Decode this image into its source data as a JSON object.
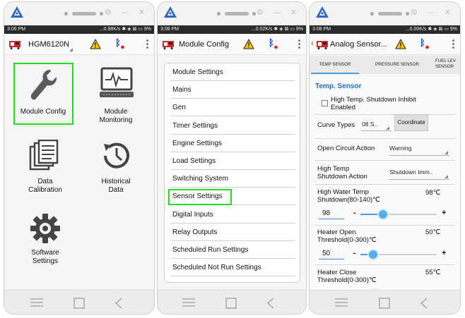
{
  "status_bars": [
    {
      "time": "3:06 PM",
      "indicators": "...0.98K/s ✱ ◈ ⊠ ▭ 9%"
    },
    {
      "time": "3:08 PM",
      "indicators": "...0.02K/s ✱ ◈ ⊠ ▭ 9%"
    },
    {
      "time": "3:08 PM",
      "indicators": "...0.00K/s ✱ ◈ ⊠ ▭ 9%"
    }
  ],
  "window_controls": "⚙ — ✕",
  "screen1": {
    "device_name": "HGM6120N",
    "grid": [
      {
        "label": "Module Config",
        "icon": "wrench-icon",
        "highlighted": true
      },
      {
        "label": "Module\nMonitoring",
        "icon": "monitor-icon",
        "highlighted": false
      },
      {
        "label": "Data\nCalibration",
        "icon": "documents-icon",
        "highlighted": false
      },
      {
        "label": "Historical\nData",
        "icon": "history-clock-icon",
        "highlighted": false
      },
      {
        "label": "Software\nSettings",
        "icon": "gear-icon",
        "highlighted": false
      }
    ]
  },
  "screen2": {
    "title": "Module Config",
    "menu": [
      "Module Settings",
      "Mains",
      "Gen",
      "Timer Settings",
      "Engine Settings",
      "Load Settings",
      "Switching System",
      "Sensor Settings",
      "Digital Inputs",
      "Relay Outputs",
      "Scheduled Run Settings",
      "Scheduled Not Run Settings"
    ],
    "highlighted_item": "Sensor Settings"
  },
  "screen3": {
    "title": "Analog Sensor...",
    "tabs": [
      "TEMP SENSOR",
      "PRESSURE SENSOR",
      "FUEL LEV\nSENSOR"
    ],
    "active_tab": "TEMP SENSOR",
    "section_title": "Temp. Sensor",
    "inhibit_label": "High Temp. Shutdown Inhibit\nEnabled",
    "inhibit_checked": false,
    "curve_label": "Curve Types",
    "curve_value": "08 S..",
    "coordinate_label": "Coordinate",
    "open_circuit_label": "Open Circuit Action",
    "open_circuit_value": "Warning",
    "high_temp_action_label": "High Temp\nShutdown Action",
    "high_temp_action_value": "Shutdown Imm..",
    "sliders": [
      {
        "label": "High Water Temp\nShutdown(80-140)℃",
        "display": "98℃",
        "input": "98",
        "min": 80,
        "max": 140,
        "value": 98
      },
      {
        "label": "Heater Open\nThreshold(0-300)℃",
        "display": "50℃",
        "input": "50",
        "min": 0,
        "max": 300,
        "value": 50
      },
      {
        "label": "Heater Close\nThreshold(0-300)℃",
        "display": "55℃",
        "input": "55",
        "min": 0,
        "max": 300,
        "value": 55
      }
    ],
    "minus": "-",
    "plus": "+"
  },
  "colors": {
    "highlight": "#22dd22",
    "accent": "#4a9ee0",
    "section_title": "#1f6fc0",
    "bluetooth": "#1a4bd6"
  }
}
